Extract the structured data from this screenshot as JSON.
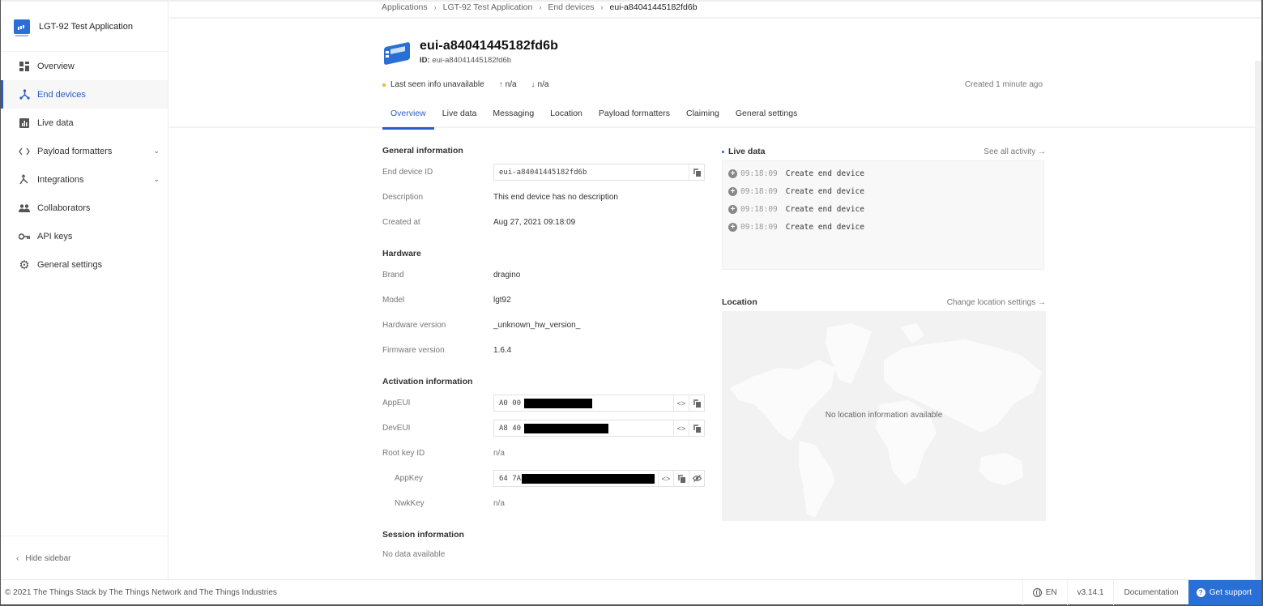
{
  "app": {
    "title": "LGT-92 Test Application"
  },
  "sidebar": {
    "items": [
      {
        "label": "Overview",
        "icon": "dashboard-icon"
      },
      {
        "label": "End devices",
        "icon": "devices-icon",
        "active": true
      },
      {
        "label": "Live data",
        "icon": "chart-icon"
      },
      {
        "label": "Payload formatters",
        "icon": "code-icon",
        "expandable": true
      },
      {
        "label": "Integrations",
        "icon": "merge-icon",
        "expandable": true
      },
      {
        "label": "Collaborators",
        "icon": "people-icon"
      },
      {
        "label": "API keys",
        "icon": "key-icon"
      },
      {
        "label": "General settings",
        "icon": "gear-icon"
      }
    ],
    "hide_label": "Hide sidebar"
  },
  "breadcrumb": [
    "Applications",
    "LGT-92 Test Application",
    "End devices",
    "eui-a84041445182fd6b"
  ],
  "device": {
    "name": "eui-a84041445182fd6b",
    "id_label": "ID:",
    "id": "eui-a84041445182fd6b",
    "last_seen": "Last seen info unavailable",
    "uplink": "n/a",
    "downlink": "n/a",
    "created_ago": "Created 1 minute ago"
  },
  "tabs": [
    {
      "label": "Overview",
      "active": true
    },
    {
      "label": "Live data"
    },
    {
      "label": "Messaging"
    },
    {
      "label": "Location"
    },
    {
      "label": "Payload formatters"
    },
    {
      "label": "Claiming"
    },
    {
      "label": "General settings"
    }
  ],
  "general": {
    "title": "General information",
    "end_device_id_label": "End device ID",
    "end_device_id": "eui-a84041445182fd6b",
    "description_label": "Description",
    "description": "This end device has no description",
    "created_at_label": "Created at",
    "created_at": "Aug 27, 2021 09:18:09"
  },
  "hardware": {
    "title": "Hardware",
    "brand_label": "Brand",
    "brand": "dragino",
    "model_label": "Model",
    "model": "lgt92",
    "hw_version_label": "Hardware version",
    "hw_version": "_unknown_hw_version_",
    "fw_version_label": "Firmware version",
    "fw_version": "1.6.4"
  },
  "activation": {
    "title": "Activation information",
    "app_eui_label": "AppEUI",
    "app_eui_prefix": "A0 00",
    "dev_eui_label": "DevEUI",
    "dev_eui_prefix": "A8 40",
    "root_key_id_label": "Root key ID",
    "root_key_id": "n/a",
    "app_key_label": "AppKey",
    "app_key_prefix": "64 7A",
    "nwk_key_label": "NwkKey",
    "nwk_key": "n/a"
  },
  "session": {
    "title": "Session information",
    "value": "No data available"
  },
  "live_data": {
    "title": "Live data",
    "link": "See all activity →",
    "events": [
      {
        "time": "09:18:09",
        "desc": "Create end device"
      },
      {
        "time": "09:18:09",
        "desc": "Create end device"
      },
      {
        "time": "09:18:09",
        "desc": "Create end device"
      },
      {
        "time": "09:18:09",
        "desc": "Create end device"
      }
    ]
  },
  "location": {
    "title": "Location",
    "link": "Change location settings →",
    "empty": "No location information available"
  },
  "footer": {
    "copyright": "© 2021 The Things Stack by The Things Network and The Things Industries",
    "language": "EN",
    "version": "v3.14.1",
    "docs": "Documentation",
    "support": "Get support",
    "support_color": "#2a6fd6"
  }
}
